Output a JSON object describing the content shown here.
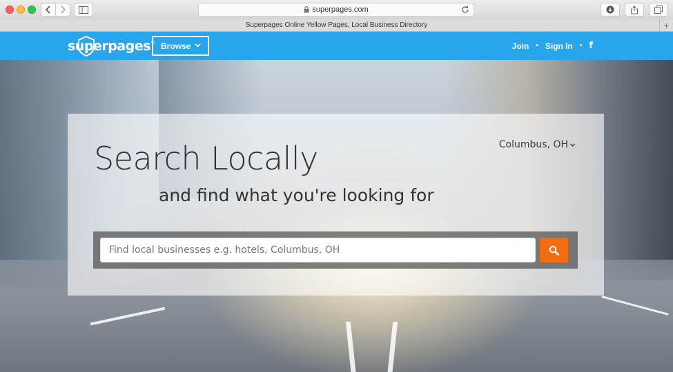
{
  "browser": {
    "address": "superpages.com",
    "tab_title": "Superpages Online Yellow Pages, Local Business Directory"
  },
  "header": {
    "logo_text": "superpages",
    "logo_mark": "®",
    "browse_label": "Browse",
    "links": [
      "Join",
      "Sign In"
    ],
    "social_icon": "facebook-icon",
    "brand_color": "#28a6ed"
  },
  "hero": {
    "headline": "Search Locally",
    "subhead": "and find what you're looking for",
    "location": "Columbus, OH",
    "search_placeholder": "Find local businesses e.g. hotels, Columbus, OH",
    "search_button_icon": "search-icon",
    "accent_color": "#f26d0f"
  }
}
